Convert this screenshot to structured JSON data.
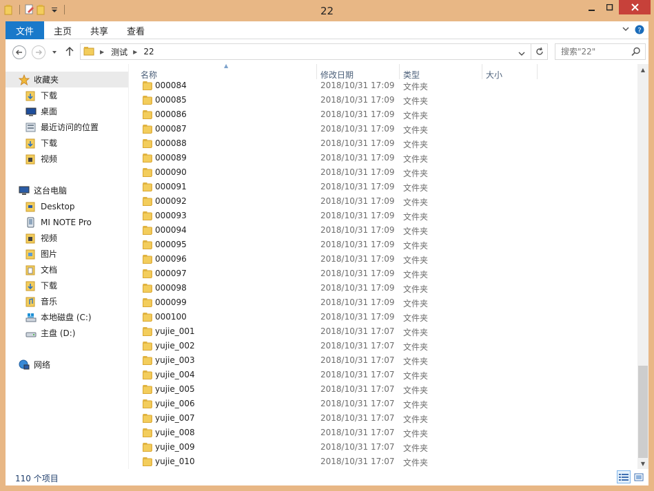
{
  "window": {
    "title": "22"
  },
  "ribbon": {
    "tabs": [
      "文件",
      "主页",
      "共享",
      "查看"
    ]
  },
  "address": {
    "breadcrumbs": [
      "测试",
      "22"
    ],
    "search_placeholder": "搜索\"22\""
  },
  "nav": {
    "items": [
      {
        "label": "收藏夹",
        "icon": "star-icon"
      },
      {
        "label": "下载",
        "icon": "download-folder-icon"
      },
      {
        "label": "桌面",
        "icon": "desktop-icon"
      },
      {
        "label": "最近访问的位置",
        "icon": "recent-places-icon"
      },
      {
        "label": "下载",
        "icon": "download-folder-icon"
      },
      {
        "label": "视频",
        "icon": "video-folder-icon"
      },
      {
        "label": "这台电脑",
        "icon": "computer-icon"
      },
      {
        "label": "Desktop",
        "icon": "folder-icon"
      },
      {
        "label": "MI NOTE Pro",
        "icon": "phone-icon"
      },
      {
        "label": "视频",
        "icon": "video-folder-icon"
      },
      {
        "label": "图片",
        "icon": "pictures-folder-icon"
      },
      {
        "label": "文档",
        "icon": "documents-folder-icon"
      },
      {
        "label": "下载",
        "icon": "download-folder-icon"
      },
      {
        "label": "音乐",
        "icon": "music-folder-icon"
      },
      {
        "label": "本地磁盘 (C:)",
        "icon": "system-drive-icon"
      },
      {
        "label": "主盘 (D:)",
        "icon": "drive-icon"
      },
      {
        "label": "网络",
        "icon": "network-icon"
      }
    ]
  },
  "columns": {
    "name": "名称",
    "date": "修改日期",
    "type": "类型",
    "size": "大小"
  },
  "files": [
    {
      "name": "000084",
      "date": "2018/10/31 17:09",
      "type": "文件夹"
    },
    {
      "name": "000085",
      "date": "2018/10/31 17:09",
      "type": "文件夹"
    },
    {
      "name": "000086",
      "date": "2018/10/31 17:09",
      "type": "文件夹"
    },
    {
      "name": "000087",
      "date": "2018/10/31 17:09",
      "type": "文件夹"
    },
    {
      "name": "000088",
      "date": "2018/10/31 17:09",
      "type": "文件夹"
    },
    {
      "name": "000089",
      "date": "2018/10/31 17:09",
      "type": "文件夹"
    },
    {
      "name": "000090",
      "date": "2018/10/31 17:09",
      "type": "文件夹"
    },
    {
      "name": "000091",
      "date": "2018/10/31 17:09",
      "type": "文件夹"
    },
    {
      "name": "000092",
      "date": "2018/10/31 17:09",
      "type": "文件夹"
    },
    {
      "name": "000093",
      "date": "2018/10/31 17:09",
      "type": "文件夹"
    },
    {
      "name": "000094",
      "date": "2018/10/31 17:09",
      "type": "文件夹"
    },
    {
      "name": "000095",
      "date": "2018/10/31 17:09",
      "type": "文件夹"
    },
    {
      "name": "000096",
      "date": "2018/10/31 17:09",
      "type": "文件夹"
    },
    {
      "name": "000097",
      "date": "2018/10/31 17:09",
      "type": "文件夹"
    },
    {
      "name": "000098",
      "date": "2018/10/31 17:09",
      "type": "文件夹"
    },
    {
      "name": "000099",
      "date": "2018/10/31 17:09",
      "type": "文件夹"
    },
    {
      "name": "000100",
      "date": "2018/10/31 17:09",
      "type": "文件夹"
    },
    {
      "name": "yujie_001",
      "date": "2018/10/31 17:07",
      "type": "文件夹"
    },
    {
      "name": "yujie_002",
      "date": "2018/10/31 17:07",
      "type": "文件夹"
    },
    {
      "name": "yujie_003",
      "date": "2018/10/31 17:07",
      "type": "文件夹"
    },
    {
      "name": "yujie_004",
      "date": "2018/10/31 17:07",
      "type": "文件夹"
    },
    {
      "name": "yujie_005",
      "date": "2018/10/31 17:07",
      "type": "文件夹"
    },
    {
      "name": "yujie_006",
      "date": "2018/10/31 17:07",
      "type": "文件夹"
    },
    {
      "name": "yujie_007",
      "date": "2018/10/31 17:07",
      "type": "文件夹"
    },
    {
      "name": "yujie_008",
      "date": "2018/10/31 17:07",
      "type": "文件夹"
    },
    {
      "name": "yujie_009",
      "date": "2018/10/31 17:07",
      "type": "文件夹"
    },
    {
      "name": "yujie_010",
      "date": "2018/10/31 17:07",
      "type": "文件夹"
    }
  ],
  "status": {
    "item_count": "110 个项目"
  },
  "colors": {
    "frame": "#e8b785",
    "file_tab": "#1979ca",
    "close_button": "#c7413a",
    "folder": "#f3cd5c"
  }
}
